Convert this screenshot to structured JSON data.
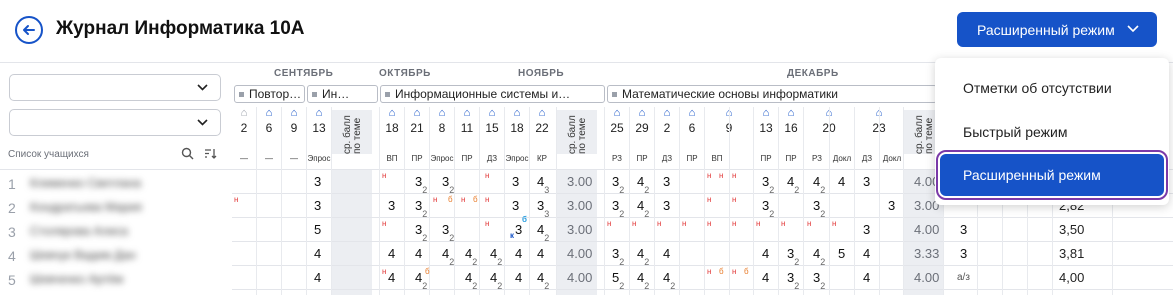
{
  "header": {
    "title": "Журнал Информатика 10А",
    "mode_button": "Расширенный режим"
  },
  "left_panel": {
    "students_label": "Список учащихся",
    "students": [
      {
        "num": "1",
        "name": "Клименко Светлана"
      },
      {
        "num": "2",
        "name": "Кондратьева Мария"
      },
      {
        "num": "3",
        "name": "Столярова Алиса"
      },
      {
        "num": "4",
        "name": "Шевчук Вадим Дан"
      },
      {
        "num": "5",
        "name": "Шевченко Артём"
      }
    ]
  },
  "months": [
    "СЕНТЯБРЬ",
    "ОКТЯБРЬ",
    "НОЯБРЬ",
    "ДЕКАБРЬ"
  ],
  "topics": [
    "Повтор…",
    "Ин…",
    "Информационные системы и…",
    "Математические основы информатики"
  ],
  "avg_label": "ср. балл по теме",
  "columns": [
    {
      "date": "2",
      "type": "—"
    },
    {
      "date": "6",
      "type": "—"
    },
    {
      "date": "9",
      "type": "—"
    },
    {
      "date": "13",
      "type": "Эпрос"
    },
    {
      "date": "18",
      "type": "ВП"
    },
    {
      "date": "21",
      "type": "ПР"
    },
    {
      "date": "8",
      "type": "Эпрос"
    },
    {
      "date": "11",
      "type": "ПР"
    },
    {
      "date": "15",
      "type": "ДЗ"
    },
    {
      "date": "18",
      "type": "Эпрос"
    },
    {
      "date": "22",
      "type": "КР"
    },
    {
      "date": "25",
      "type": "РЗ"
    },
    {
      "date": "29",
      "type": "ПР"
    },
    {
      "date": "2",
      "type": "ДЗ"
    },
    {
      "date": "6",
      "type": "ПР"
    },
    {
      "date": "9",
      "type": "ВП"
    },
    {
      "date": "13",
      "type": "ПР"
    },
    {
      "date": "16",
      "type": "ПР"
    },
    {
      "date": "20",
      "type": "РЗ"
    },
    {
      "date": "23",
      "type": "Докл"
    },
    {
      "date": "",
      "type": "ДЗ"
    },
    {
      "date": "",
      "type": "Докл"
    }
  ],
  "marks": {
    "r1": {
      "c13": "3",
      "c21": "3",
      "c8": "3",
      "c15": "3",
      "c18b": "4",
      "avg1": "3.00",
      "c25": "3",
      "c29": "4",
      "c2": "3",
      "c13b": "3",
      "c16": "4",
      "c20": "4",
      "c20b": "4",
      "c23": "3",
      "avg2": "4.00"
    },
    "r2": {
      "c13": "3",
      "c18": "3",
      "c21": "3",
      "c15": "3",
      "c18b": "3",
      "c22": "3",
      "avg1": "3.00",
      "c25": "3",
      "c29": "4",
      "c2": "3",
      "c13b": "3",
      "c20": "3",
      "c23b": "3",
      "avg2": "3.00",
      "final": "2,82"
    },
    "r3": {
      "c13": "5",
      "c21": "3",
      "c8": "3",
      "c15": "3",
      "c22": "4",
      "avg1": "3.00",
      "c23": "3",
      "avg2": "4.00",
      "extra": "3",
      "final": "3,50"
    },
    "r4": {
      "c13": "4",
      "c18": "4",
      "c21": "4",
      "c8": "4",
      "c11": "4",
      "c15": "4",
      "c18b": "4",
      "c22": "4",
      "avg1": "4.00",
      "c25": "3",
      "c29": "4",
      "c2": "4",
      "c13b": "4",
      "c16": "3",
      "c20": "4",
      "c20b": "5",
      "c23": "4",
      "avg2": "3.33",
      "extra": "3",
      "final": "3,81"
    },
    "r5": {
      "c13": "4",
      "c18": "4",
      "c21": "4",
      "c11": "4",
      "c15": "4",
      "c18b": "4",
      "c22": "4",
      "avg1": "4.00",
      "c25": "5",
      "c29": "4",
      "c2": "4",
      "c13b": "4",
      "c16": "3",
      "c20": "3",
      "c23": "4",
      "avg2": "4.00",
      "extra": "а/з",
      "final": "4,00"
    }
  },
  "dropdown": {
    "items": [
      "Отметки об отсутствии",
      "Быстрый режим",
      "Расширенный режим"
    ],
    "active_index": 2
  },
  "colors": {
    "accent": "#1653c8",
    "absence": "#e23b3b",
    "sick": "#e87c2a",
    "highlight_outline": "#7a39a8"
  }
}
